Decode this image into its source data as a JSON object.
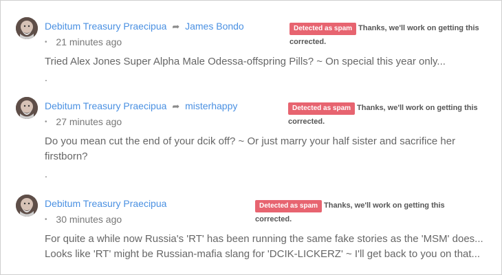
{
  "spam": {
    "badge": "Detected as spam",
    "msg_line1": "Thanks, we'll work on getting this",
    "msg_line2": "corrected."
  },
  "comments": [
    {
      "author": "Debitum Treasury Praecipua",
      "reply_to": "James Bondo",
      "time": "21 minutes ago",
      "body_lines": [
        "Tried Alex Jones Super Alpha Male Odessa-offspring Pills? ~ On special this year only..."
      ],
      "trailing": "."
    },
    {
      "author": "Debitum Treasury Praecipua",
      "reply_to": "misterhappy",
      "time": "27 minutes ago",
      "body_lines": [
        "Do you mean cut the end of your dcik off? ~ Or just marry your half sister and sacrifice her",
        "firstborn?"
      ],
      "trailing": "."
    },
    {
      "author": "Debitum Treasury Praecipua",
      "reply_to": "",
      "time": "30 minutes ago",
      "body_lines": [
        "For quite a while now Russia's 'RT' has been running the same fake stories as the 'MSM' does...",
        "Looks like 'RT' might be Russian-mafia slang for 'DCIK-LICKERZ' ~ I'll get back to you on that..."
      ],
      "trailing": ""
    }
  ],
  "icons": {
    "reply_arrow": "reply-arrow-icon",
    "avatar": "avatar"
  }
}
